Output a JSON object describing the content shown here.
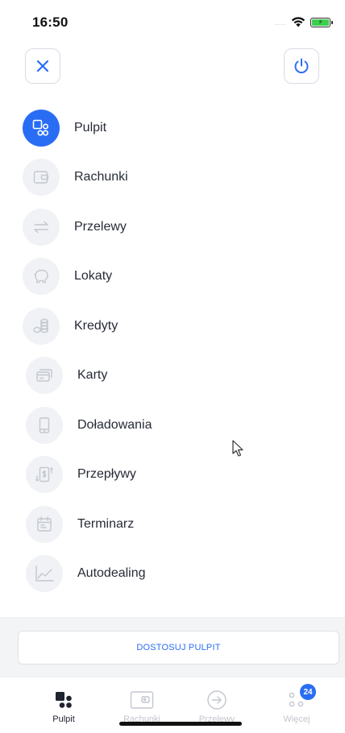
{
  "status_bar": {
    "time": "16:50",
    "signal": "....",
    "wifi_icon": "wifi-icon",
    "battery_icon": "battery-charging-icon"
  },
  "header": {
    "close_icon": "close-icon",
    "power_icon": "power-icon"
  },
  "menu": {
    "items": [
      {
        "label": "Pulpit",
        "icon": "dashboard-icon",
        "active": true
      },
      {
        "label": "Rachunki",
        "icon": "wallet-icon",
        "active": false
      },
      {
        "label": "Przelewy",
        "icon": "transfer-arrows-icon",
        "active": false
      },
      {
        "label": "Lokaty",
        "icon": "piggy-bank-icon",
        "active": false
      },
      {
        "label": "Kredyty",
        "icon": "coins-icon",
        "active": false
      },
      {
        "label": "Karty",
        "icon": "cards-icon",
        "active": false
      },
      {
        "label": "Doładowania",
        "icon": "phone-icon",
        "active": false
      },
      {
        "label": "Przepływy",
        "icon": "cash-flow-icon",
        "active": false
      },
      {
        "label": "Terminarz",
        "icon": "calendar-icon",
        "active": false
      },
      {
        "label": "Autodealing",
        "icon": "chart-line-icon",
        "active": false
      }
    ]
  },
  "customize": {
    "label": "DOSTOSUJ PULPIT"
  },
  "tab_bar": {
    "tabs": [
      {
        "label": "Pulpit",
        "icon": "dashboard-tab-icon",
        "active": true
      },
      {
        "label": "Rachunki",
        "icon": "wallet-tab-icon",
        "active": false
      },
      {
        "label": "Przelewy",
        "icon": "arrow-circle-icon",
        "active": false
      },
      {
        "label": "Więcej",
        "icon": "more-icon",
        "active": false,
        "badge": "24"
      }
    ]
  },
  "colors": {
    "accent": "#2a6df5",
    "icon_bg": "#f0f2f5",
    "icon_stroke": "#c3c8cf",
    "text": "#262b36",
    "muted": "#c2c6cd"
  }
}
